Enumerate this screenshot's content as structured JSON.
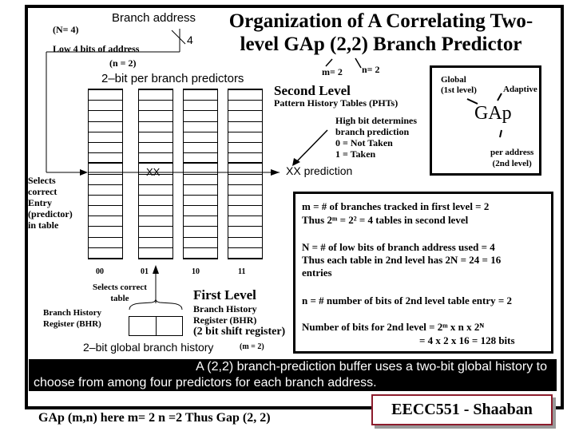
{
  "title": {
    "line1": "Organization of A Correlating Two-",
    "line2": "level GAp (2,2) Branch Predictor"
  },
  "annotations": {
    "n_equals_4": "(N= 4)",
    "branch_address": "Branch address",
    "address_width": "4",
    "low_bits": "Low 4 bits of address",
    "n_equals_2_top": "(n = 2)",
    "m_equals_2": "m= 2",
    "n_equals_2": "n= 2",
    "predictors_label": "2–bit per branch predictors",
    "second_level": "Second Level",
    "phts": "Pattern History Tables (PHTs)",
    "high_bit": [
      "High bit determines",
      "branch prediction",
      "0  =  Not Taken",
      "1 =  Taken"
    ],
    "xx_cell": "XX",
    "xx_prediction": "XX prediction",
    "selects_entry": [
      "Selects",
      "correct",
      "Entry",
      "(predictor)",
      " in table"
    ],
    "table_labels": [
      "00",
      "01",
      "10",
      "11"
    ],
    "selects_table": [
      "Selects correct",
      "table"
    ],
    "bhr_left": [
      "Branch History",
      "Register (BHR)"
    ],
    "first_level": "First Level",
    "bhr_right": [
      "Branch History",
      " Register (BHR)",
      "(2 bit shift register)"
    ],
    "global_history": "2–bit global branch history",
    "m_equals_2_bottom": "(m = 2)"
  },
  "gap_box": {
    "global": [
      "Global",
      "(1st level)"
    ],
    "adaptive": "Adaptive",
    "gap": "GAp",
    "per_address": [
      "per address",
      "(2nd level)"
    ]
  },
  "info_box": {
    "m_def": "m =  # of  branches tracked  in first level  = 2",
    "m_thus": "Thus  2ᵐ  =  2² = 4   tables in second level",
    "N_def": "N = # of low bits of branch address used  = 4",
    "N_thus": "Thus each table in 2nd level  has  2N  = 24 = 16",
    "N_thus2": "entries",
    "n_def": "n =  #  number of bits of 2nd level table entry = 2",
    "bits_def": "Number of bits for 2nd level = 2ᵐ x  n x 2ᴺ",
    "bits_result": "=  4  x  2 x  16 = 128 bits"
  },
  "caption": {
    "line1": "A  (2,2)  branch-prediction  buffer  uses  a  two-bit  global  history  to",
    "line2": "choose from among four predictors for each branch address."
  },
  "footer": {
    "gap_note": "GAp (m,n)   here  m= 2    n =2   Thus  Gap (2, 2)",
    "badge": "EECC551 - Shaaban"
  },
  "colors": {
    "badge_border": "#8c1c2c",
    "badge_shadow": "#999999"
  }
}
